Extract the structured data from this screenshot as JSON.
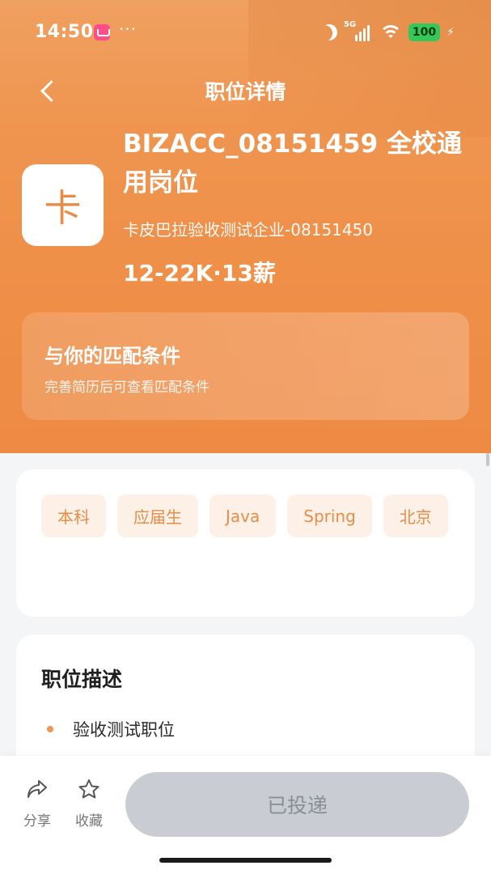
{
  "status_bar": {
    "time": "14:50",
    "dots": "···",
    "network": "5G",
    "battery": "100"
  },
  "nav": {
    "title": "职位详情"
  },
  "company": {
    "logo_char": "卡",
    "name": "卡皮巴拉验收测试企业-08151450"
  },
  "job": {
    "title": "BIZACC_08151459 全校通用岗位",
    "salary": "12-22K·13薪"
  },
  "match": {
    "title": "与你的匹配条件",
    "subtitle": "完善简历后可查看匹配条件"
  },
  "tags": [
    "本科",
    "应届生",
    "Java",
    "Spring",
    "北京"
  ],
  "description": {
    "title": "职位描述",
    "items": [
      "验收测试职位"
    ]
  },
  "bottom_bar": {
    "share_label": "分享",
    "favorite_label": "收藏",
    "apply_label": "已投递"
  },
  "colors": {
    "accent": "#ee8f48",
    "tag_bg": "#fdf1e7",
    "tag_text": "#e88c48",
    "disabled_button": "#c9ccd2"
  }
}
